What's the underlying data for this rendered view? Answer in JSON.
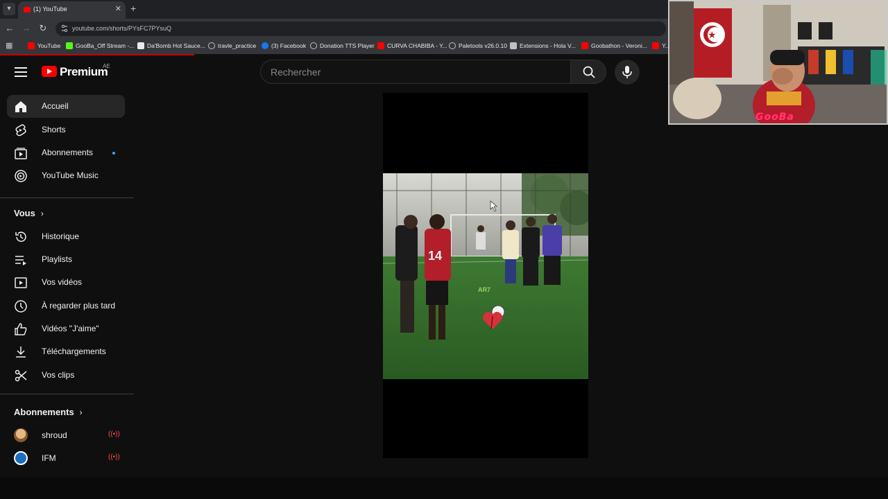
{
  "browser": {
    "tab_title": "(1) YouTube",
    "url": "youtube.com/shorts/PYsFC7PYsuQ",
    "bookmarks": [
      {
        "label": "YouTube",
        "color": "#ff0000"
      },
      {
        "label": "GooBa_Off Stream -...",
        "color": "#53fc18"
      },
      {
        "label": "Da'Bomb Hot Sauce...",
        "color": "#e8eaed"
      },
      {
        "label": "travle_practice",
        "color": "#bdc1c6"
      },
      {
        "label": "(3) Facebook",
        "color": "#1877f2"
      },
      {
        "label": "Donation TTS Player",
        "color": "#bdc1c6"
      },
      {
        "label": "CURVA CHABIBA - Y...",
        "color": "#ff0000"
      },
      {
        "label": "Paletools v26.0.10",
        "color": "#bdc1c6"
      },
      {
        "label": "Extensions - Hola V...",
        "color": "#bdc1c6"
      },
      {
        "label": "Goobathon - Veroni...",
        "color": "#ff0000"
      },
      {
        "label": "Y...",
        "color": "#ff0000"
      }
    ]
  },
  "header": {
    "brand": "Premium",
    "country": "AE",
    "search_placeholder": "Rechercher"
  },
  "sidebar": {
    "main": [
      {
        "label": "Accueil",
        "icon": "home-icon",
        "active": true
      },
      {
        "label": "Shorts",
        "icon": "shorts-icon"
      },
      {
        "label": "Abonnements",
        "icon": "subscriptions-icon",
        "dot": true
      },
      {
        "label": "YouTube Music",
        "icon": "music-icon"
      }
    ],
    "you_heading": "Vous",
    "you": [
      {
        "label": "Historique",
        "icon": "history-icon"
      },
      {
        "label": "Playlists",
        "icon": "playlists-icon"
      },
      {
        "label": "Vos vidéos",
        "icon": "your-videos-icon"
      },
      {
        "label": "À regarder plus tard",
        "icon": "watch-later-icon"
      },
      {
        "label": "Vidéos \"J'aime\"",
        "icon": "liked-icon"
      },
      {
        "label": "Téléchargements",
        "icon": "downloads-icon"
      },
      {
        "label": "Vos clips",
        "icon": "clips-icon"
      }
    ],
    "subs_heading": "Abonnements",
    "subs": [
      {
        "label": "shroud",
        "live": true
      },
      {
        "label": "IFM",
        "live": true
      }
    ]
  },
  "short": {
    "overlay_text": "AR7",
    "player_number": "14"
  },
  "webcam": {
    "name": "GooBa"
  }
}
